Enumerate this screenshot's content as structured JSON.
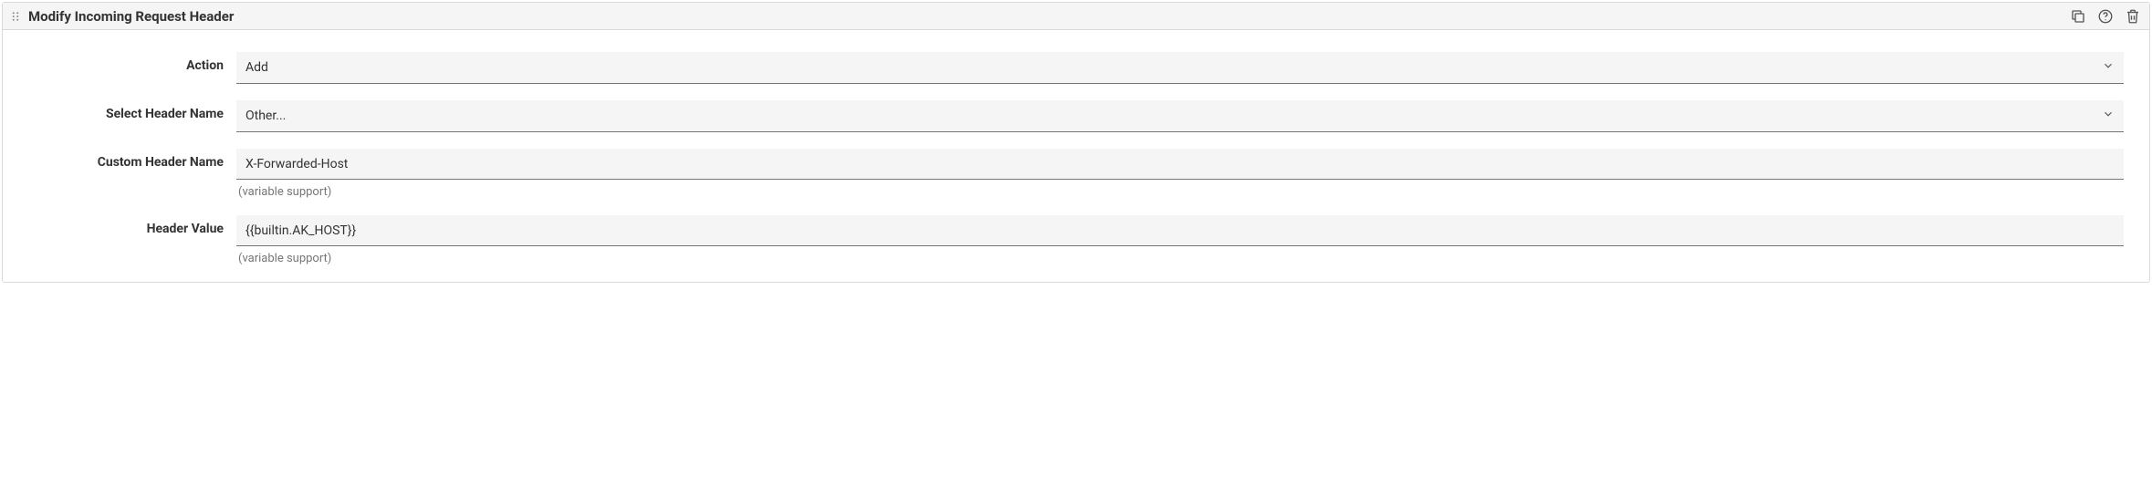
{
  "panel": {
    "title": "Modify Incoming Request Header"
  },
  "form": {
    "action": {
      "label": "Action",
      "value": "Add"
    },
    "selectHeader": {
      "label": "Select Header Name",
      "value": "Other..."
    },
    "customHeader": {
      "label": "Custom Header Name",
      "value": "X-Forwarded-Host",
      "hint": "(variable support)"
    },
    "headerValue": {
      "label": "Header Value",
      "value": "{{builtin.AK_HOST}}",
      "hint": "(variable support)"
    }
  }
}
